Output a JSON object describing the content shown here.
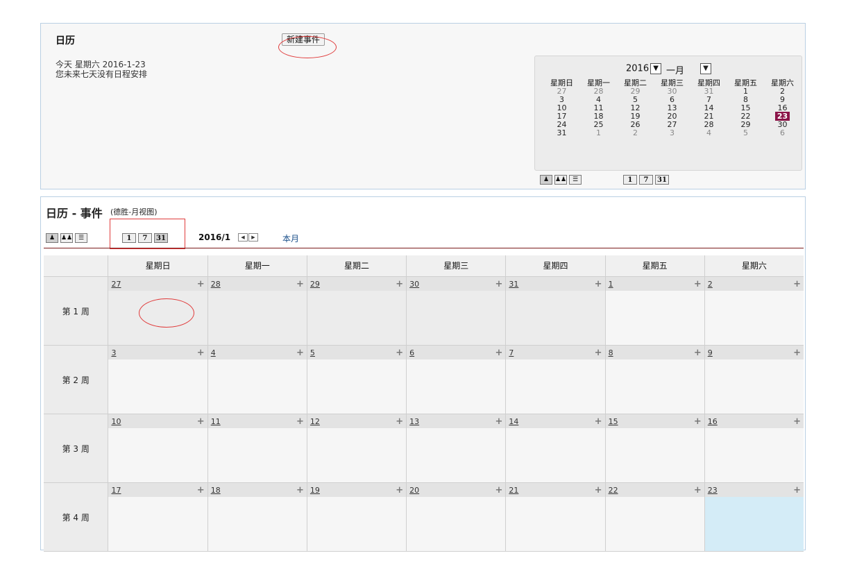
{
  "summary": {
    "title": "日历",
    "new_event_label": "新建事件",
    "today_line": "今天 星期六 2016-1-23",
    "upcoming_line": "您未来七天没有日程安排"
  },
  "mini_calendar": {
    "year": "2016",
    "month": "一月",
    "weekdays": [
      "星期日",
      "星期一",
      "星期二",
      "星期三",
      "星期四",
      "星期五",
      "星期六"
    ],
    "weeks": [
      [
        "27",
        "28",
        "29",
        "30",
        "31",
        "1",
        "2"
      ],
      [
        "3",
        "4",
        "5",
        "6",
        "7",
        "8",
        "9"
      ],
      [
        "10",
        "11",
        "12",
        "13",
        "14",
        "15",
        "16"
      ],
      [
        "17",
        "18",
        "19",
        "20",
        "21",
        "22",
        "23"
      ],
      [
        "24",
        "25",
        "26",
        "27",
        "28",
        "29",
        "30"
      ],
      [
        "31",
        "1",
        "2",
        "3",
        "4",
        "5",
        "6"
      ]
    ],
    "today": "23",
    "view_buttons": [
      "1",
      "7",
      "31"
    ]
  },
  "main": {
    "title": "日历 - 事件",
    "subtitle": "(德胜-月视图)",
    "view_buttons": [
      "1",
      "7",
      "31"
    ],
    "month_label": "2016/1",
    "this_month": "本月",
    "weekdays": [
      "星期日",
      "星期一",
      "星期二",
      "星期三",
      "星期四",
      "星期五",
      "星期六"
    ],
    "weeks": [
      {
        "label": "第 1 周",
        "days": [
          "27",
          "28",
          "29",
          "30",
          "31",
          "1",
          "2"
        ]
      },
      {
        "label": "第 2 周",
        "days": [
          "3",
          "4",
          "5",
          "6",
          "7",
          "8",
          "9"
        ]
      },
      {
        "label": "第 3 周",
        "days": [
          "10",
          "11",
          "12",
          "13",
          "14",
          "15",
          "16"
        ]
      },
      {
        "label": "第 4 周",
        "days": [
          "17",
          "18",
          "19",
          "20",
          "21",
          "22",
          "23"
        ]
      }
    ],
    "add_symbol": "+"
  },
  "colors": {
    "today_highlight": "#8b1448",
    "annotation_red": "#e03b3b",
    "today_cell": "#d4ecf7",
    "link_blue": "#1a4f8a"
  }
}
